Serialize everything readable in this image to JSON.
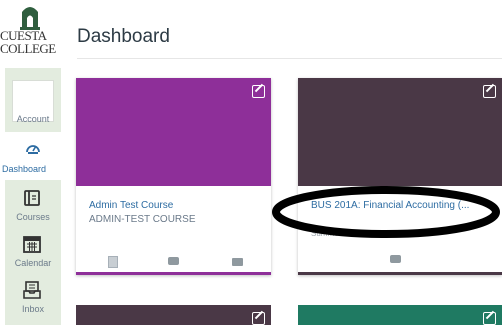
{
  "logo": {
    "line1": "CUESTA",
    "line2": "COLLEGE"
  },
  "nav": {
    "account": "Account",
    "dashboard": "Dashboard",
    "courses": "Courses",
    "calendar": "Calendar",
    "inbox": "Inbox"
  },
  "header": {
    "title": "Dashboard"
  },
  "cards": [
    {
      "name": "Admin Test Course",
      "code": "ADMIN-TEST COURSE",
      "color": "#8e2f99"
    },
    {
      "name": "BUS 201A: Financial Accounting (...",
      "term": "Summer 2015",
      "color": "#4a3846"
    },
    {
      "color": "#4a3846"
    },
    {
      "color": "#1f7a62"
    }
  ],
  "colors": {
    "accent": "#2d6ca2",
    "rail": "#e3ecdf"
  }
}
